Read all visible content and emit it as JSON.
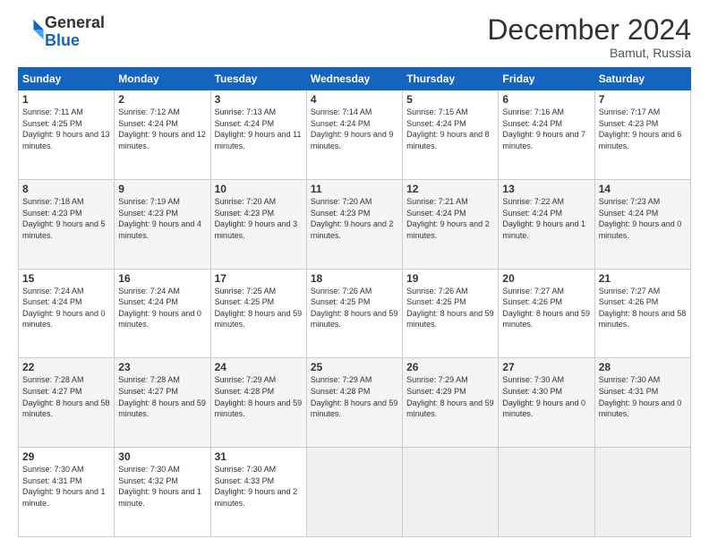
{
  "logo": {
    "general": "General",
    "blue": "Blue"
  },
  "header": {
    "month": "December 2024",
    "location": "Bamut, Russia"
  },
  "weekdays": [
    "Sunday",
    "Monday",
    "Tuesday",
    "Wednesday",
    "Thursday",
    "Friday",
    "Saturday"
  ],
  "weeks": [
    [
      {
        "day": "1",
        "sunrise": "Sunrise: 7:11 AM",
        "sunset": "Sunset: 4:25 PM",
        "daylight": "Daylight: 9 hours and 13 minutes."
      },
      {
        "day": "2",
        "sunrise": "Sunrise: 7:12 AM",
        "sunset": "Sunset: 4:24 PM",
        "daylight": "Daylight: 9 hours and 12 minutes."
      },
      {
        "day": "3",
        "sunrise": "Sunrise: 7:13 AM",
        "sunset": "Sunset: 4:24 PM",
        "daylight": "Daylight: 9 hours and 11 minutes."
      },
      {
        "day": "4",
        "sunrise": "Sunrise: 7:14 AM",
        "sunset": "Sunset: 4:24 PM",
        "daylight": "Daylight: 9 hours and 9 minutes."
      },
      {
        "day": "5",
        "sunrise": "Sunrise: 7:15 AM",
        "sunset": "Sunset: 4:24 PM",
        "daylight": "Daylight: 9 hours and 8 minutes."
      },
      {
        "day": "6",
        "sunrise": "Sunrise: 7:16 AM",
        "sunset": "Sunset: 4:24 PM",
        "daylight": "Daylight: 9 hours and 7 minutes."
      },
      {
        "day": "7",
        "sunrise": "Sunrise: 7:17 AM",
        "sunset": "Sunset: 4:23 PM",
        "daylight": "Daylight: 9 hours and 6 minutes."
      }
    ],
    [
      {
        "day": "8",
        "sunrise": "Sunrise: 7:18 AM",
        "sunset": "Sunset: 4:23 PM",
        "daylight": "Daylight: 9 hours and 5 minutes."
      },
      {
        "day": "9",
        "sunrise": "Sunrise: 7:19 AM",
        "sunset": "Sunset: 4:23 PM",
        "daylight": "Daylight: 9 hours and 4 minutes."
      },
      {
        "day": "10",
        "sunrise": "Sunrise: 7:20 AM",
        "sunset": "Sunset: 4:23 PM",
        "daylight": "Daylight: 9 hours and 3 minutes."
      },
      {
        "day": "11",
        "sunrise": "Sunrise: 7:20 AM",
        "sunset": "Sunset: 4:23 PM",
        "daylight": "Daylight: 9 hours and 2 minutes."
      },
      {
        "day": "12",
        "sunrise": "Sunrise: 7:21 AM",
        "sunset": "Sunset: 4:24 PM",
        "daylight": "Daylight: 9 hours and 2 minutes."
      },
      {
        "day": "13",
        "sunrise": "Sunrise: 7:22 AM",
        "sunset": "Sunset: 4:24 PM",
        "daylight": "Daylight: 9 hours and 1 minute."
      },
      {
        "day": "14",
        "sunrise": "Sunrise: 7:23 AM",
        "sunset": "Sunset: 4:24 PM",
        "daylight": "Daylight: 9 hours and 0 minutes."
      }
    ],
    [
      {
        "day": "15",
        "sunrise": "Sunrise: 7:24 AM",
        "sunset": "Sunset: 4:24 PM",
        "daylight": "Daylight: 9 hours and 0 minutes."
      },
      {
        "day": "16",
        "sunrise": "Sunrise: 7:24 AM",
        "sunset": "Sunset: 4:24 PM",
        "daylight": "Daylight: 9 hours and 0 minutes."
      },
      {
        "day": "17",
        "sunrise": "Sunrise: 7:25 AM",
        "sunset": "Sunset: 4:25 PM",
        "daylight": "Daylight: 8 hours and 59 minutes."
      },
      {
        "day": "18",
        "sunrise": "Sunrise: 7:26 AM",
        "sunset": "Sunset: 4:25 PM",
        "daylight": "Daylight: 8 hours and 59 minutes."
      },
      {
        "day": "19",
        "sunrise": "Sunrise: 7:26 AM",
        "sunset": "Sunset: 4:25 PM",
        "daylight": "Daylight: 8 hours and 59 minutes."
      },
      {
        "day": "20",
        "sunrise": "Sunrise: 7:27 AM",
        "sunset": "Sunset: 4:26 PM",
        "daylight": "Daylight: 8 hours and 59 minutes."
      },
      {
        "day": "21",
        "sunrise": "Sunrise: 7:27 AM",
        "sunset": "Sunset: 4:26 PM",
        "daylight": "Daylight: 8 hours and 58 minutes."
      }
    ],
    [
      {
        "day": "22",
        "sunrise": "Sunrise: 7:28 AM",
        "sunset": "Sunset: 4:27 PM",
        "daylight": "Daylight: 8 hours and 58 minutes."
      },
      {
        "day": "23",
        "sunrise": "Sunrise: 7:28 AM",
        "sunset": "Sunset: 4:27 PM",
        "daylight": "Daylight: 8 hours and 59 minutes."
      },
      {
        "day": "24",
        "sunrise": "Sunrise: 7:29 AM",
        "sunset": "Sunset: 4:28 PM",
        "daylight": "Daylight: 8 hours and 59 minutes."
      },
      {
        "day": "25",
        "sunrise": "Sunrise: 7:29 AM",
        "sunset": "Sunset: 4:28 PM",
        "daylight": "Daylight: 8 hours and 59 minutes."
      },
      {
        "day": "26",
        "sunrise": "Sunrise: 7:29 AM",
        "sunset": "Sunset: 4:29 PM",
        "daylight": "Daylight: 8 hours and 59 minutes."
      },
      {
        "day": "27",
        "sunrise": "Sunrise: 7:30 AM",
        "sunset": "Sunset: 4:30 PM",
        "daylight": "Daylight: 9 hours and 0 minutes."
      },
      {
        "day": "28",
        "sunrise": "Sunrise: 7:30 AM",
        "sunset": "Sunset: 4:31 PM",
        "daylight": "Daylight: 9 hours and 0 minutes."
      }
    ],
    [
      {
        "day": "29",
        "sunrise": "Sunrise: 7:30 AM",
        "sunset": "Sunset: 4:31 PM",
        "daylight": "Daylight: 9 hours and 1 minute."
      },
      {
        "day": "30",
        "sunrise": "Sunrise: 7:30 AM",
        "sunset": "Sunset: 4:32 PM",
        "daylight": "Daylight: 9 hours and 1 minute."
      },
      {
        "day": "31",
        "sunrise": "Sunrise: 7:30 AM",
        "sunset": "Sunset: 4:33 PM",
        "daylight": "Daylight: 9 hours and 2 minutes."
      },
      null,
      null,
      null,
      null
    ]
  ]
}
